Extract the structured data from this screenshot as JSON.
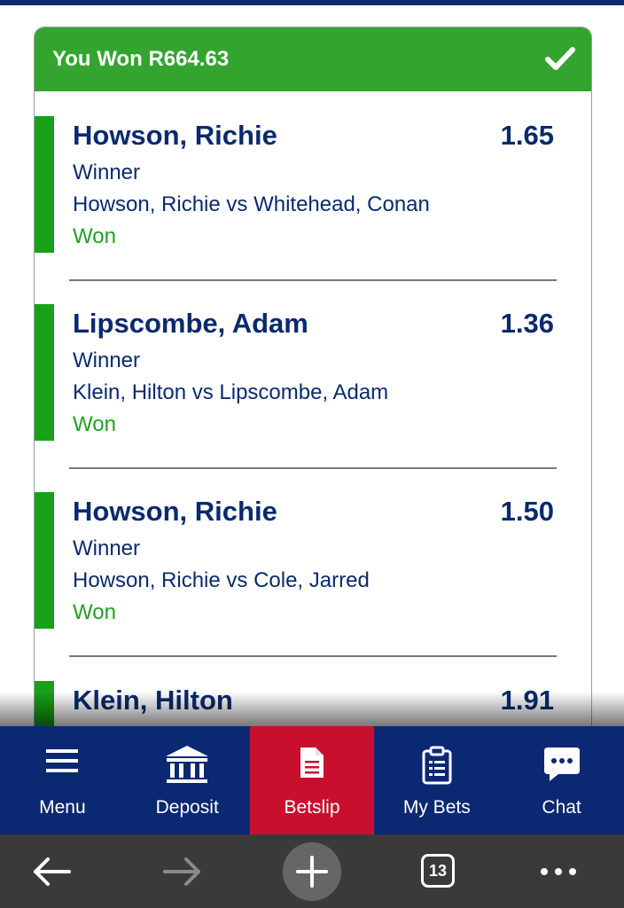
{
  "header": {
    "title": "You Won R664.63",
    "color": "#33a52e"
  },
  "bets": [
    {
      "selection": "Howson, Richie",
      "odds": "1.65",
      "market": "Winner",
      "event": "Howson, Richie vs Whitehead, Conan",
      "status": "Won"
    },
    {
      "selection": "Lipscombe, Adam",
      "odds": "1.36",
      "market": "Winner",
      "event": "Klein, Hilton vs Lipscombe, Adam",
      "status": "Won"
    },
    {
      "selection": "Howson, Richie",
      "odds": "1.50",
      "market": "Winner",
      "event": "Howson, Richie vs Cole, Jarred",
      "status": "Won"
    },
    {
      "selection": "Klein, Hilton",
      "odds": "1.91"
    }
  ],
  "nav": {
    "items": [
      {
        "label": "Menu",
        "icon": "hamburger-icon"
      },
      {
        "label": "Deposit",
        "icon": "bank-icon"
      },
      {
        "label": "Betslip",
        "icon": "document-icon",
        "active": true
      },
      {
        "label": "My Bets",
        "icon": "clipboard-icon"
      },
      {
        "label": "Chat",
        "icon": "chat-bubble-icon"
      }
    ],
    "background": "#0b2873",
    "active_color": "#c8102e"
  },
  "browser": {
    "tab_count": "13"
  }
}
